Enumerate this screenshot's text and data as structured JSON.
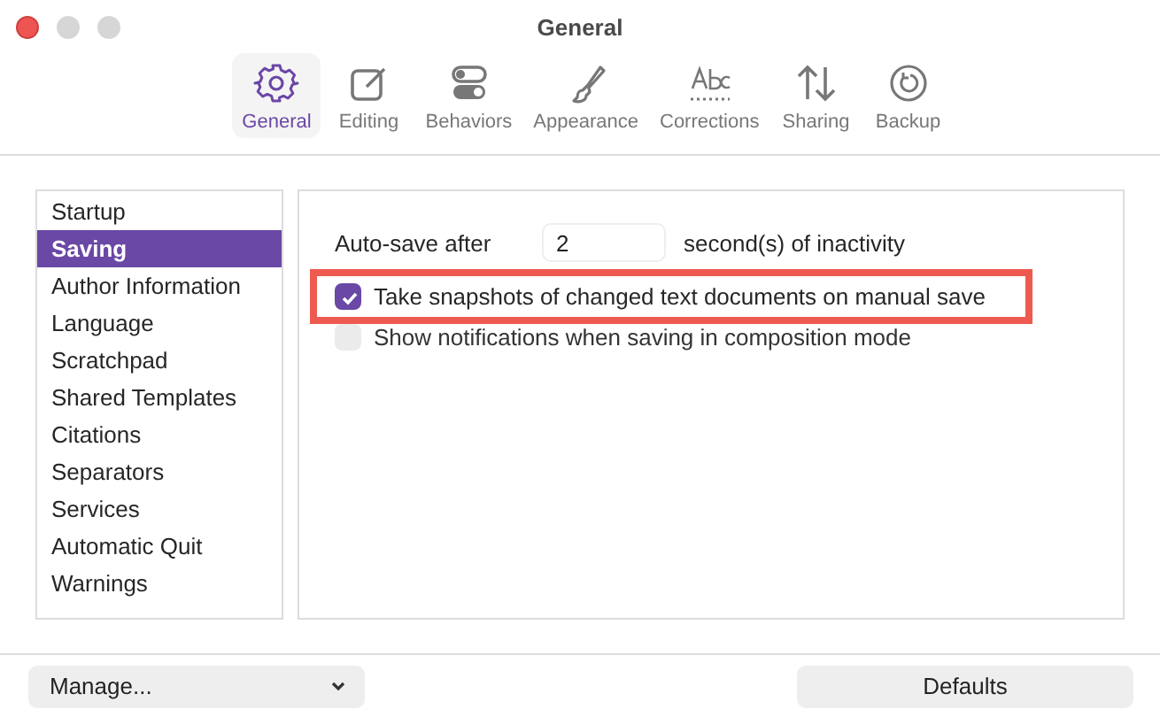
{
  "window": {
    "title": "General"
  },
  "toolbar": [
    {
      "kind": "gear",
      "label": "General",
      "selected": true
    },
    {
      "kind": "pencil",
      "label": "Editing",
      "selected": false
    },
    {
      "kind": "toggles",
      "label": "Behaviors",
      "selected": false
    },
    {
      "kind": "brush",
      "label": "Appearance",
      "selected": false
    },
    {
      "kind": "abc",
      "label": "Corrections",
      "selected": false
    },
    {
      "kind": "arrows",
      "label": "Sharing",
      "selected": false
    },
    {
      "kind": "restore",
      "label": "Backup",
      "selected": false
    }
  ],
  "sidebar": {
    "items": [
      {
        "label": "Startup",
        "selected": false
      },
      {
        "label": "Saving",
        "selected": true
      },
      {
        "label": "Author Information",
        "selected": false
      },
      {
        "label": "Language",
        "selected": false
      },
      {
        "label": "Scratchpad",
        "selected": false
      },
      {
        "label": "Shared Templates",
        "selected": false
      },
      {
        "label": "Citations",
        "selected": false
      },
      {
        "label": "Separators",
        "selected": false
      },
      {
        "label": "Services",
        "selected": false
      },
      {
        "label": "Automatic Quit",
        "selected": false
      },
      {
        "label": "Warnings",
        "selected": false
      }
    ]
  },
  "autosave": {
    "label": "Auto-save after",
    "value": "2",
    "suffix": "second(s) of inactivity"
  },
  "options": [
    {
      "label": "Take snapshots of changed text documents on manual save",
      "checked": true,
      "disabled": false,
      "highlighted": true
    },
    {
      "label": "Show notifications when saving in composition mode",
      "checked": false,
      "disabled": true,
      "highlighted": false
    }
  ],
  "footer": {
    "manage": "Manage...",
    "defaults": "Defaults"
  }
}
